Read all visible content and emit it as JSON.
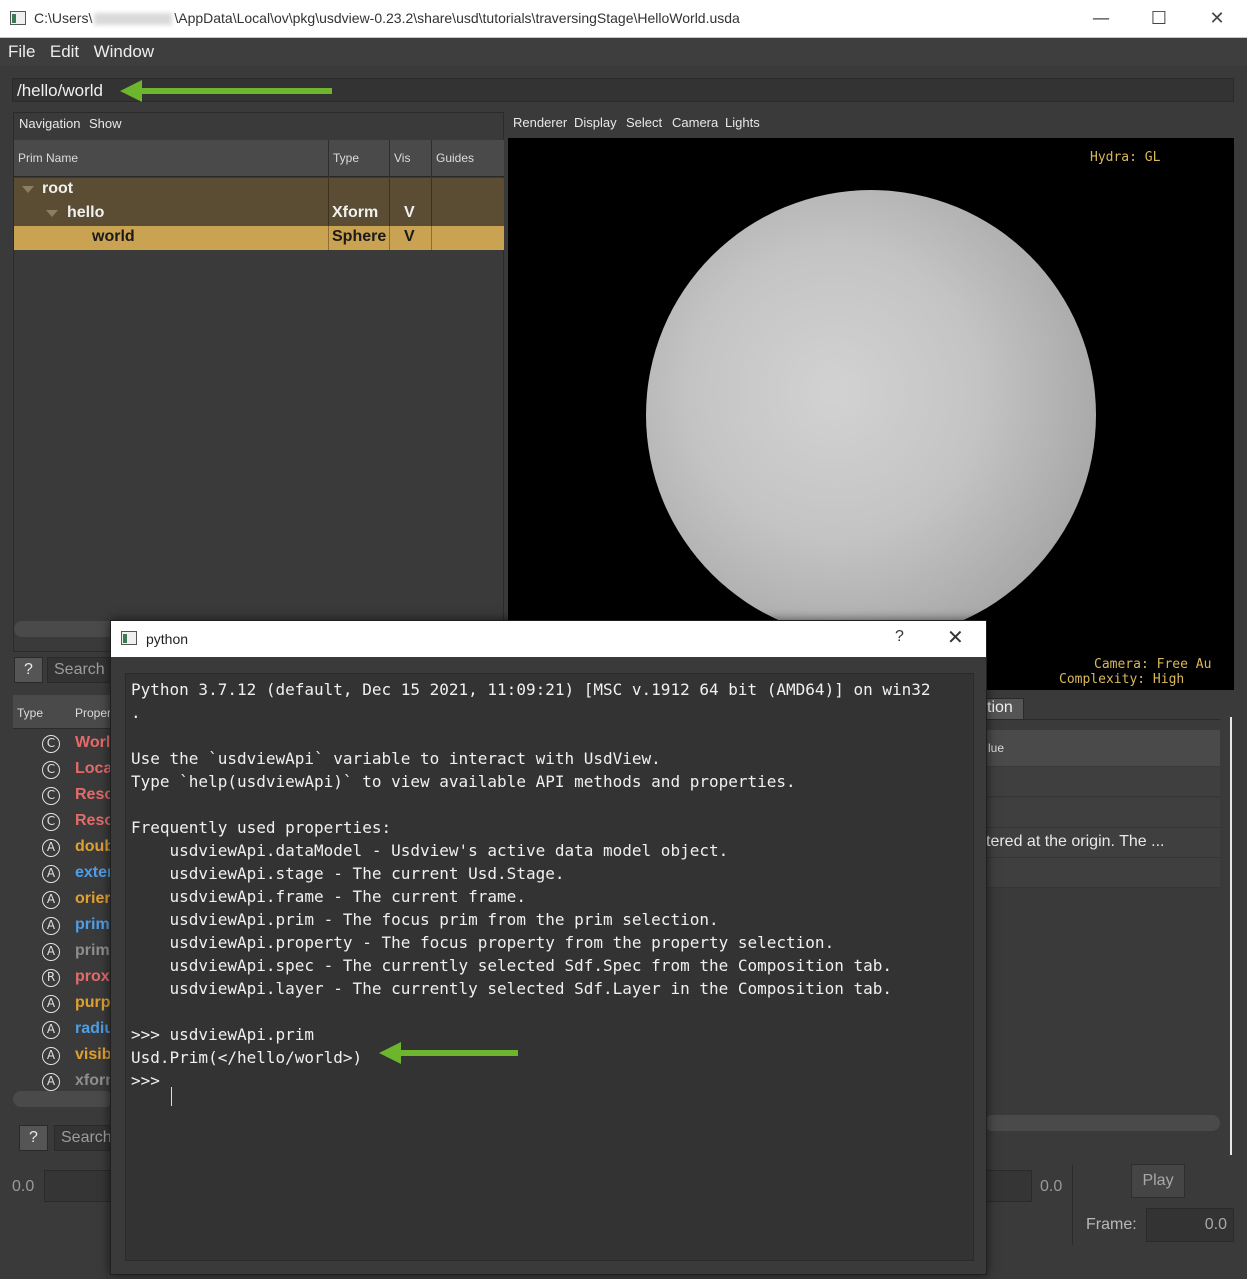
{
  "window": {
    "title_prefix": "C:\\Users\\",
    "title_suffix": "\\AppData\\Local\\ov\\pkg\\usdview-0.23.2\\share\\usd\\tutorials\\traversingStage\\HelloWorld.usda",
    "minimize": "—",
    "maximize": "☐",
    "close": "✕"
  },
  "menu": [
    "File",
    "Edit",
    "Window"
  ],
  "path": "/hello/world",
  "left_panel": {
    "menu": [
      "Navigation",
      "Show"
    ],
    "columns": [
      "Prim Name",
      "Type",
      "Vis",
      "Guides"
    ],
    "rows": [
      {
        "name": "root",
        "type": "",
        "vis": ""
      },
      {
        "name": "hello",
        "type": "Xform",
        "vis": "V"
      },
      {
        "name": "world",
        "type": "Sphere",
        "vis": "V"
      }
    ],
    "search_q": "?",
    "search_placeholder": "Search"
  },
  "properties": {
    "columns": [
      "Type",
      "Proper"
    ],
    "rows": [
      {
        "icon": "C",
        "name": "Worl",
        "color": "#e56b6b"
      },
      {
        "icon": "C",
        "name": "Loca",
        "color": "#e56b6b"
      },
      {
        "icon": "C",
        "name": "Reso",
        "color": "#e56b6b"
      },
      {
        "icon": "C",
        "name": "Reso",
        "color": "#e56b6b"
      },
      {
        "icon": "A",
        "name": "doub",
        "color": "#e0a030"
      },
      {
        "icon": "A",
        "name": "exter",
        "color": "#4f9ee8"
      },
      {
        "icon": "A",
        "name": "orier",
        "color": "#e0a030"
      },
      {
        "icon": "A",
        "name": "prim",
        "color": "#4f9ee8"
      },
      {
        "icon": "A",
        "name": "prim",
        "color": "#8e8e8e"
      },
      {
        "icon": "R",
        "name": "prox",
        "color": "#e56b6b"
      },
      {
        "icon": "A",
        "name": "purp",
        "color": "#e0a030"
      },
      {
        "icon": "A",
        "name": "radiu",
        "color": "#4f9ee8"
      },
      {
        "icon": "A",
        "name": "visib",
        "color": "#e0a030"
      },
      {
        "icon": "A",
        "name": "xforn",
        "color": "#8e8e8e"
      }
    ],
    "search_q": "?",
    "search_placeholder": "Search"
  },
  "viewport": {
    "menu": [
      "Renderer",
      "Display",
      "Select",
      "Camera",
      "Lights"
    ],
    "hydra": "Hydra: GL",
    "camera": "Camera: Free Au",
    "complexity": "Complexity: High"
  },
  "right_lower": {
    "tab": "tion",
    "header": "lue",
    "rows": [
      "",
      "",
      "tered at the origin. The ...",
      ""
    ]
  },
  "bottom": {
    "left_value": "0.0",
    "right_value": "0.0",
    "play": "Play",
    "frame_label": "Frame:",
    "frame_value": "0.0"
  },
  "python": {
    "title": "python",
    "help": "?",
    "close": "✕",
    "lines": [
      "Python 3.7.12 (default, Dec 15 2021, 11:09:21) [MSC v.1912 64 bit (AMD64)] on win32",
      ".",
      "",
      "Use the `usdviewApi` variable to interact with UsdView.",
      "Type `help(usdviewApi)` to view available API methods and properties.",
      "",
      "Frequently used properties:",
      "    usdviewApi.dataModel - Usdview's active data model object.",
      "    usdviewApi.stage - The current Usd.Stage.",
      "    usdviewApi.frame - The current frame.",
      "    usdviewApi.prim - The focus prim from the prim selection.",
      "    usdviewApi.property - The focus property from the property selection.",
      "    usdviewApi.spec - The currently selected Sdf.Spec from the Composition tab.",
      "    usdviewApi.layer - The currently selected Sdf.Layer in the Composition tab.",
      "",
      ">>> usdviewApi.prim",
      "Usd.Prim(</hello/world>)",
      ">>> "
    ]
  },
  "colors": {
    "arrow": "#6cb52d",
    "selection": "#c9a252",
    "tree_bg": "#5a4d34",
    "hud": "#d9b85a"
  }
}
